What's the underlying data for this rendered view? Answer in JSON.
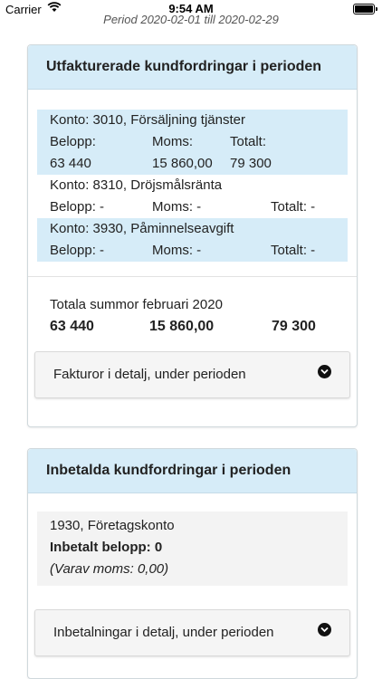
{
  "status_bar": {
    "carrier": "Carrier",
    "time": "9:54 AM"
  },
  "period_text": "Period 2020-02-01 till 2020-02-29",
  "invoiced": {
    "title": "Utfakturerade kundfordringar i perioden",
    "accounts": [
      {
        "label": "Konto: 3010, Försäljning tjänster",
        "belopp_label": "Belopp:",
        "moms_label": "Moms:",
        "totalt_label": "Totalt:",
        "belopp": "63 440",
        "moms": "15 860,00",
        "totalt": "79 300"
      },
      {
        "label": "Konto: 8310, Dröjsmålsränta",
        "belopp_label": "Belopp: -",
        "moms_label": "Moms: -",
        "totalt_label": "Totalt: -"
      },
      {
        "label": "Konto: 3930, Påminnelseavgift",
        "belopp_label": "Belopp: -",
        "moms_label": "Moms: -",
        "totalt_label": "Totalt: -"
      }
    ],
    "totals_title": "Totala summor februari 2020",
    "totals": {
      "belopp": "63 440",
      "moms": "15 860,00",
      "totalt": "79 300"
    },
    "details_label": "Fakturor i detalj, under perioden"
  },
  "paid": {
    "title": "Inbetalda kundfordringar i perioden",
    "account": "1930, Företagskonto",
    "amount_label": "Inbetalt belopp: 0",
    "vat_note": "(Varav moms: 0,00)",
    "details_label": "Inbetalningar i detalj, under perioden"
  },
  "colors": {
    "header_bg": "#d6ecf8",
    "highlight_bg": "#d6ecf8",
    "accordion_bg": "#f5f5f5"
  }
}
